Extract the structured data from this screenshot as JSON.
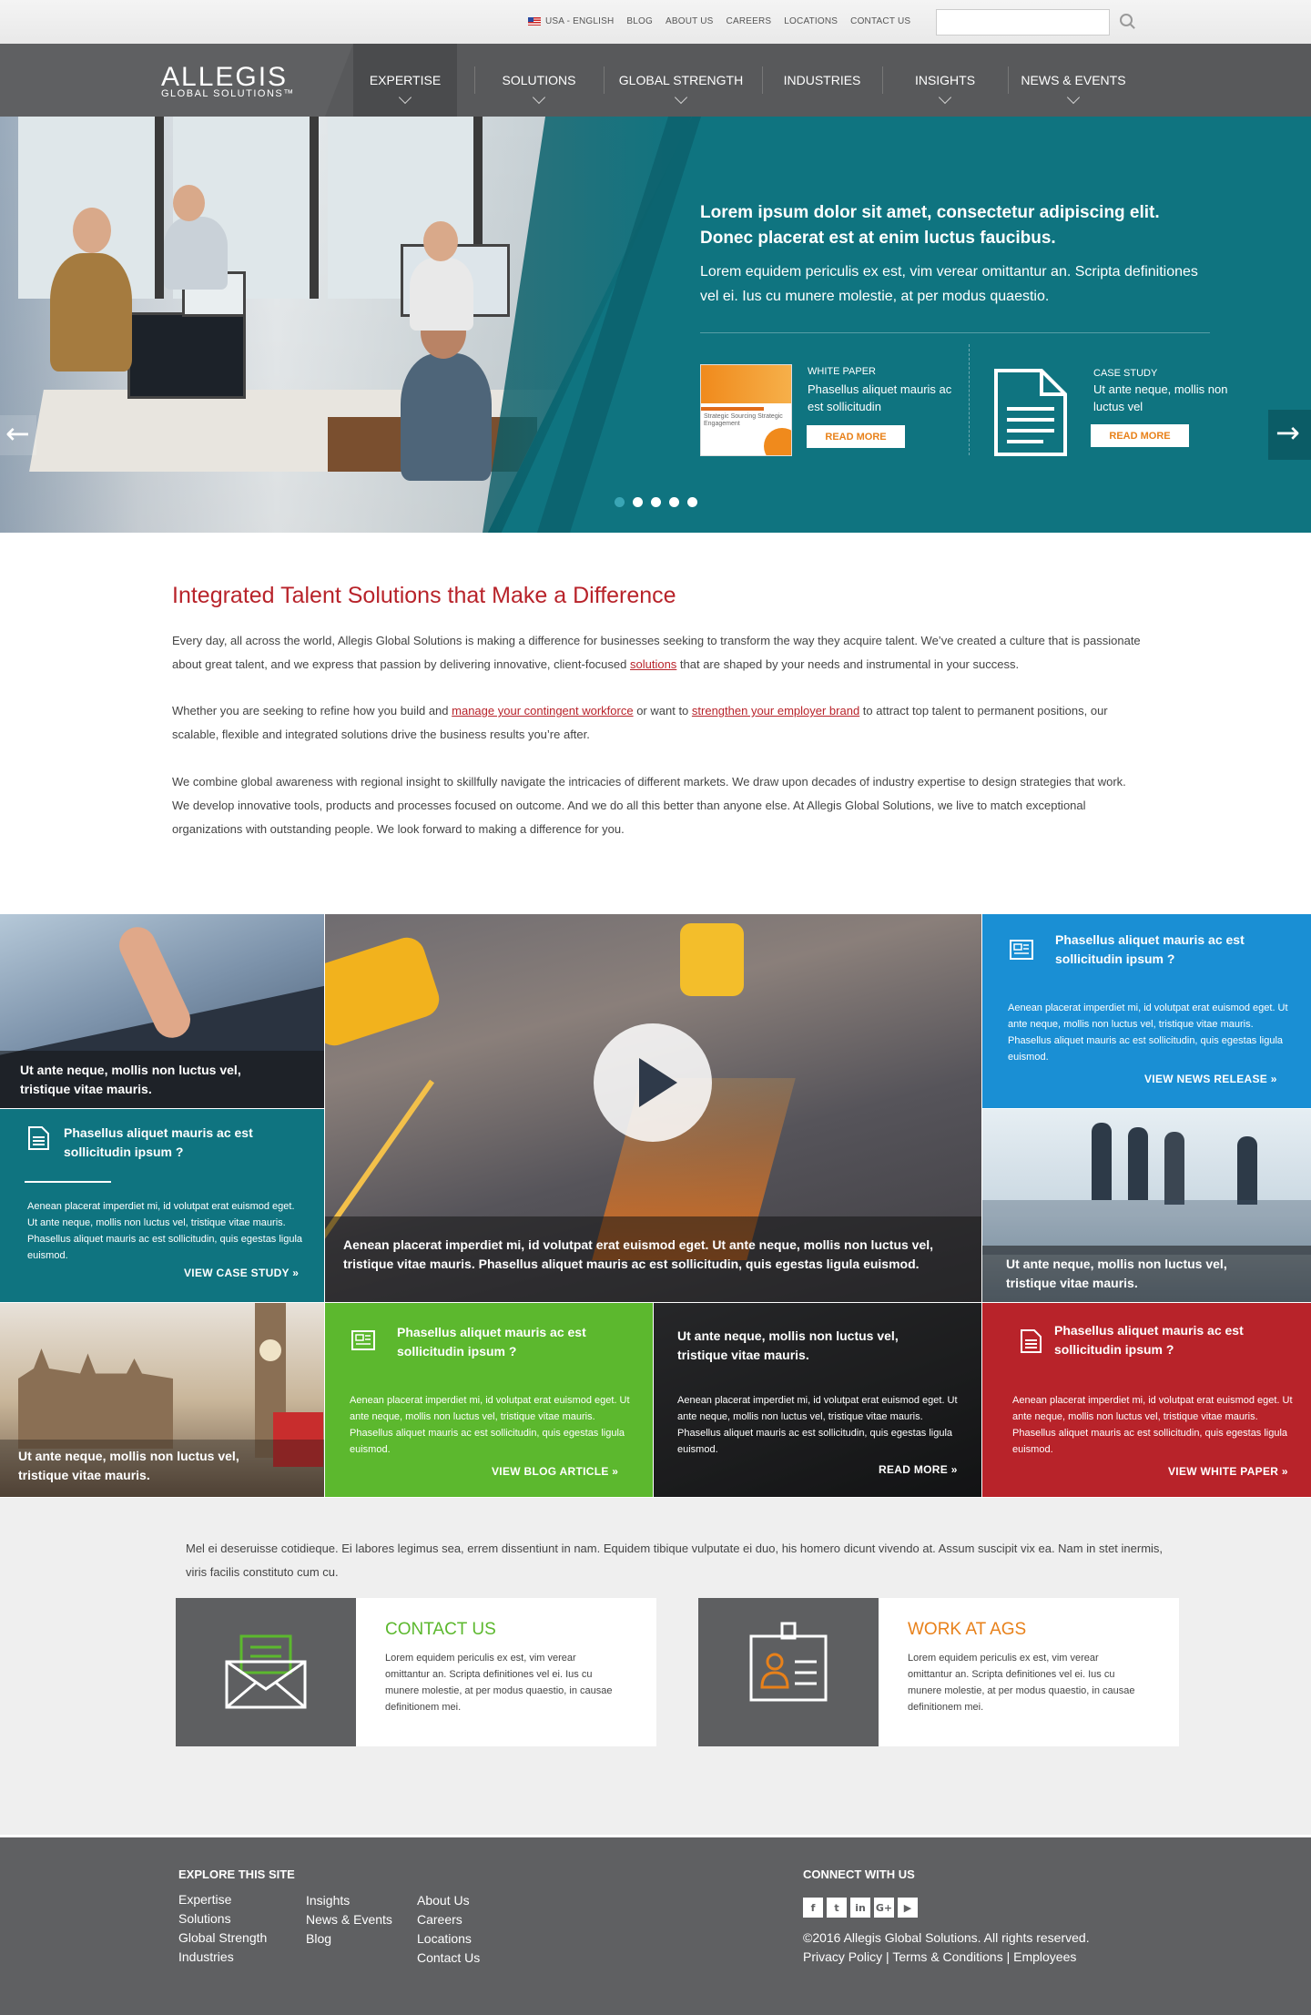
{
  "utility": {
    "locale": "USA - ENGLISH",
    "links": [
      "BLOG",
      "ABOUT US",
      "CAREERS",
      "LOCATIONS",
      "CONTACT US"
    ],
    "search_placeholder": ""
  },
  "brand": {
    "name": "ALLEGIS",
    "sub": "GLOBAL SOLUTIONS™"
  },
  "nav": {
    "items": [
      "EXPERTISE",
      "SOLUTIONS",
      "GLOBAL STRENGTH",
      "INDUSTRIES",
      "INSIGHTS",
      "NEWS & EVENTS"
    ],
    "active": "EXPERTISE"
  },
  "hero": {
    "heading": "Lorem ipsum dolor sit amet, consectetur adipiscing elit. Donec placerat est at enim luctus faucibus.",
    "text": "Lorem equidem periculis ex est, vim verear omittantur an. Scripta definitiones vel ei. Ius cu munere molestie, at per modus quaestio.",
    "resources": [
      {
        "type": "WHITE PAPER",
        "desc": "Phasellus aliquet mauris ac est sollicitudin",
        "button": "READ MORE",
        "thumb_text": "Strategic Sourcing Strategic Engagement"
      },
      {
        "type": "CASE STUDY",
        "desc": "Ut ante neque, mollis non luctus vel",
        "button": "READ MORE"
      }
    ],
    "slides": 5,
    "active_slide": 1
  },
  "intro": {
    "title": "Integrated Talent Solutions that Make a Difference",
    "p1_a": "Every day, all across the world, Allegis Global Solutions is making a difference for businesses seeking to transform the way they acquire talent. We’ve created a culture that is passionate about great talent, and we express that passion by delivering innovative, client-focused ",
    "p1_link": "solutions",
    "p1_b": " that are shaped by your needs and instrumental in your success.",
    "p2_a": "Whether you are seeking to refine how you build and ",
    "p2_link1": "manage your contingent workforce",
    "p2_b": " or want to ",
    "p2_link2": "strengthen your employer brand",
    "p2_c": " to attract top talent to permanent positions, our scalable, flexible and integrated solutions drive the business results you’re after.",
    "p3": "We combine global awareness with regional insight to skillfully navigate the intricacies of different markets. We draw upon decades of industry expertise to design strategies that work. We develop innovative tools, products and processes focused on outcome. And we do all this better than anyone else. At Allegis Global Solutions, we live to match exceptional organizations with outstanding people. We look forward to making a difference for you."
  },
  "tiles": {
    "tablet_caption": "Ut ante neque, mollis non luctus vel, tristique vitae mauris.",
    "case_title": "Phasellus aliquet mauris ac est sollicitudin ipsum ?",
    "case_body": "Aenean placerat imperdiet mi, id volutpat erat euismod eget. Ut ante neque, mollis non luctus vel, tristique vitae mauris. Phasellus aliquet mauris ac est sollicitudin, quis egestas ligula euismod.",
    "case_link": "VIEW CASE STUDY",
    "video_caption": "Aenean placerat imperdiet mi, id volutpat erat euismod eget. Ut ante neque, mollis non luctus vel, tristique vitae mauris. Phasellus aliquet mauris ac est sollicitudin, quis egestas ligula euismod.",
    "news_title": "Phasellus aliquet mauris ac est sollicitudin ipsum ?",
    "news_body": "Aenean placerat imperdiet mi, id volutpat erat euismod eget. Ut ante neque, mollis non luctus vel, tristique vitae mauris. Phasellus aliquet mauris ac est sollicitudin, quis egestas ligula euismod.",
    "news_link": "VIEW NEWS RELEASE",
    "meeting_caption": "Ut ante neque, mollis non luctus vel, tristique vitae mauris.",
    "london_caption": "Ut ante neque, mollis non luctus vel, tristique vitae mauris.",
    "blog_title": "Phasellus aliquet mauris ac est sollicitudin ipsum ?",
    "blog_body": "Aenean placerat imperdiet mi, id volutpat erat euismod eget. Ut ante neque, mollis non luctus vel, tristique vitae mauris. Phasellus aliquet mauris ac est sollicitudin, quis egestas ligula euismod.",
    "blog_link": "VIEW BLOG ARTICLE",
    "dark_title": "Ut ante neque, mollis non luctus vel, tristique vitae mauris.",
    "dark_body": "Aenean placerat imperdiet mi, id volutpat erat euismod eget. Ut ante neque, mollis non luctus vel, tristique vitae mauris. Phasellus aliquet mauris ac est sollicitudin, quis egestas ligula euismod.",
    "dark_link": "READ MORE",
    "wp_title": "Phasellus aliquet mauris ac est sollicitudin ipsum ?",
    "wp_body": "Aenean placerat imperdiet mi, id volutpat erat euismod eget. Ut ante neque, mollis non luctus vel, tristique vitae mauris. Phasellus aliquet mauris ac est sollicitudin, quis egestas ligula euismod.",
    "wp_link": "VIEW WHITE PAPER"
  },
  "cards_intro": "Mel ei deseruisse cotidieque. Ei labores legimus sea, errem dissentiunt in nam. Equidem tibique vulputate ei duo, his homero dicunt vivendo at. Assum suscipit vix ea. Nam in stet inermis, viris facilis constituto cum cu.",
  "cards": [
    {
      "title": "CONTACT US",
      "body": "Lorem equidem periculis ex est, vim verear omittantur an. Scripta definitiones vel ei. Ius cu munere molestie, at per modus quaestio, in causae definitionem mei."
    },
    {
      "title": "WORK AT AGS",
      "body": "Lorem equidem periculis ex est, vim verear omittantur an. Scripta definitiones vel ei. Ius cu munere molestie, at per modus quaestio, in causae definitionem mei."
    }
  ],
  "footer": {
    "explore_heading": "EXPLORE THIS SITE",
    "col1": [
      "Expertise",
      "Solutions",
      "Global Strength",
      "Industries"
    ],
    "col2": [
      "Insights",
      "News & Events",
      "Blog"
    ],
    "col3": [
      "About Us",
      "Careers",
      "Locations",
      "Contact Us"
    ],
    "connect_heading": "CONNECT WITH US",
    "social": [
      "f",
      "t",
      "in",
      "G+",
      "▶"
    ],
    "copyright": "©2016 Allegis Global Solutions. All rights reserved.",
    "legal": [
      "Privacy Policy",
      "Terms & Conditions",
      "Employees"
    ]
  },
  "colors": {
    "teal": "#0f7480",
    "blue": "#1a8fd4",
    "green": "#5cb82e",
    "red": "#b8232a",
    "orange": "#e8811a",
    "gray_dark": "#5f6062"
  }
}
